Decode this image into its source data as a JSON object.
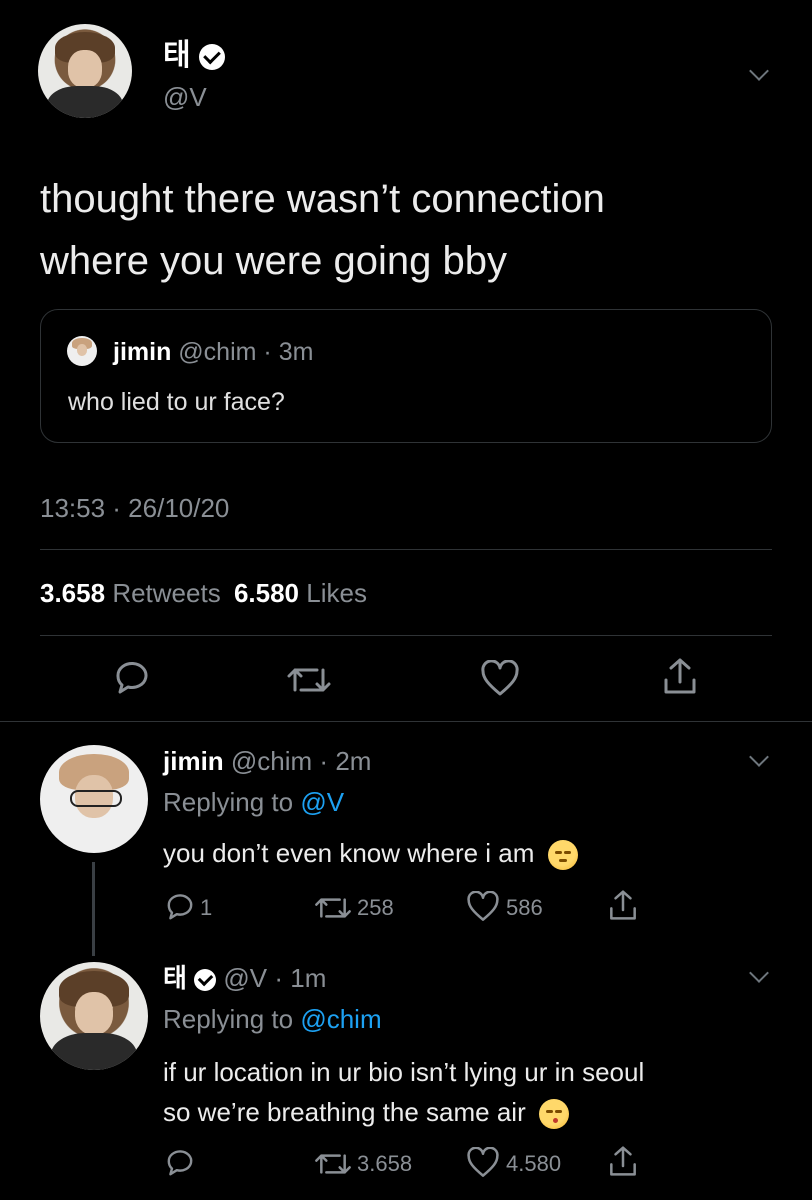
{
  "main_tweet": {
    "display_name": "태",
    "handle": "@V",
    "text_line1": "thought there wasn’t connection",
    "text_line2": "where you were going bby",
    "quoted": {
      "display_name": "jimin",
      "handle": "@chim",
      "time": "3m",
      "text": "who lied to ur face?"
    },
    "timestamp": "13:53 · 26/10/20",
    "retweets_count": "3.658",
    "retweets_label": "Retweets",
    "likes_count": "6.580",
    "likes_label": "Likes"
  },
  "replies": [
    {
      "display_name": "jimin",
      "handle": "@chim",
      "time": "2m",
      "replying_prefix": "Replying to",
      "replying_to": "@V",
      "text": "you don’t even know where i am",
      "emoji": "unamused-face",
      "reply_count": "1",
      "retweet_count": "258",
      "like_count": "586"
    },
    {
      "display_name": "태",
      "handle": "@V",
      "time": "1m",
      "replying_prefix": "Replying to",
      "replying_to": "@chim",
      "text_line1": "if ur location in ur bio isn’t lying ur in seoul",
      "text_line2": "so we’re breathing the same air",
      "emoji": "kissing-face",
      "retweet_count": "3.658",
      "like_count": "4.580"
    }
  ],
  "colors": {
    "background": "#000000",
    "text": "#d9d9d9",
    "secondary": "#8a8f95",
    "link": "#1da1f2",
    "divider": "#2f3336"
  }
}
